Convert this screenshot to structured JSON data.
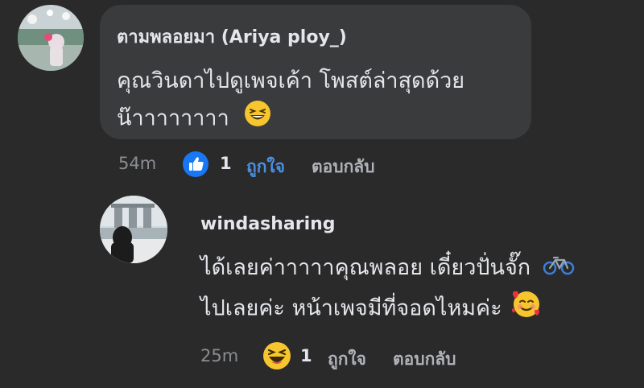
{
  "comments": [
    {
      "author": "ตามพลอยมา (Ariya ploy_)",
      "text_line1": "คุณวินดาไปดูเพจเค้า โพสต์ล่าสุดด้วย",
      "text_line2": "น๊าาาาาาาา",
      "time": "54m",
      "reaction_icon": "thumbs-up-icon",
      "reaction_count": "1",
      "like_label": "ถูกใจ",
      "reply_label": "ตอบกลับ",
      "emoji": "grinning-squinting-face"
    },
    {
      "author": "windasharing",
      "text_line1": "ได้เลยค่าาาาาคุณพลอย เดี๋ยวปั่นจั๊ก",
      "text_line2": "ไปเลยค่ะ หน้าเพจมีที่จอดไหมค่ะ",
      "time": "25m",
      "reaction_icon": "laughing-face-icon",
      "reaction_count": "1",
      "like_label": "ถูกใจ",
      "reply_label": "ตอบกลับ",
      "emoji_inline": "bicycle",
      "emoji_end": "smiling-face-with-hearts"
    }
  ],
  "colors": {
    "background": "#2a2a2b",
    "bubble": "#3a3b3c",
    "accent_like": "#1877f2",
    "text_primary": "#e4e6eb",
    "text_secondary": "#b0b3b8"
  }
}
